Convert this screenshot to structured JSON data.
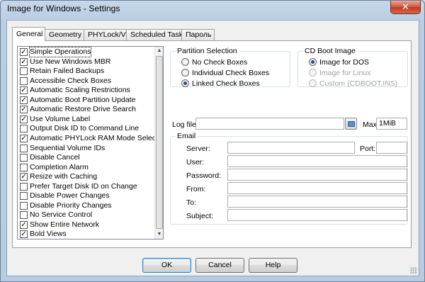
{
  "window": {
    "title": "Image for Windows - Settings",
    "close_glyph": "✕"
  },
  "tabs": [
    "General",
    "Geometry",
    "PHYLock/VSS",
    "Scheduled Tasks",
    "Пароль"
  ],
  "active_tab": "General",
  "options": [
    {
      "label": "Simple Operations",
      "checked": true
    },
    {
      "label": "Use New Windows MBR",
      "checked": true
    },
    {
      "label": "Retain Failed Backups",
      "checked": false
    },
    {
      "label": "Accessible Check Boxes",
      "checked": false
    },
    {
      "label": "Automatic Scaling Restrictions",
      "checked": true
    },
    {
      "label": "Automatic Boot Partition Update",
      "checked": true
    },
    {
      "label": "Automatic Restore Drive Search",
      "checked": true
    },
    {
      "label": "Use Volume Label",
      "checked": true
    },
    {
      "label": "Output Disk ID to Command Line",
      "checked": false
    },
    {
      "label": "Automatic PHYLock RAM Mode Select",
      "checked": true
    },
    {
      "label": "Sequential Volume IDs",
      "checked": false
    },
    {
      "label": "Disable Cancel",
      "checked": false
    },
    {
      "label": "Completion Alarm",
      "checked": false
    },
    {
      "label": "Resize with Caching",
      "checked": true
    },
    {
      "label": "Prefer Target Disk ID on Change",
      "checked": false
    },
    {
      "label": "Disable Power Changes",
      "checked": false
    },
    {
      "label": "Disable Priority Changes",
      "checked": false
    },
    {
      "label": "No Service Control",
      "checked": false
    },
    {
      "label": "Show Entire Network",
      "checked": true
    },
    {
      "label": "Bold Views",
      "checked": true
    }
  ],
  "partition_selection": {
    "title": "Partition Selection",
    "options": [
      {
        "label": "No Check Boxes",
        "selected": false
      },
      {
        "label": "Individual Check Boxes",
        "selected": false
      },
      {
        "label": "Linked Check Boxes",
        "selected": true
      }
    ]
  },
  "cd_boot": {
    "title": "CD Boot Image",
    "options": [
      {
        "label": "Image for DOS",
        "selected": true,
        "enabled": true
      },
      {
        "label": "Image for Linux",
        "selected": false,
        "enabled": false
      },
      {
        "label": "Custom (CDBOOT.INS)",
        "selected": false,
        "enabled": false
      }
    ]
  },
  "log": {
    "label": "Log file:",
    "value": "",
    "max_label": "Max:",
    "max_value": "1MiB",
    "browse_icon": "folder-icon"
  },
  "email": {
    "title": "Email",
    "server_label": "Server:",
    "server_value": "",
    "port_label": "Port:",
    "port_value": "",
    "user_label": "User:",
    "user_value": "",
    "password_label": "Password:",
    "password_value": "",
    "from_label": "From:",
    "from_value": "",
    "to_label": "To:",
    "to_value": "",
    "subject_label": "Subject:",
    "subject_value": ""
  },
  "buttons": {
    "ok": "OK",
    "cancel": "Cancel",
    "help": "Help"
  },
  "colors": {
    "titlebar": "#b9cde3",
    "close": "#c7432b",
    "checked_radio": "#2d4f80"
  }
}
